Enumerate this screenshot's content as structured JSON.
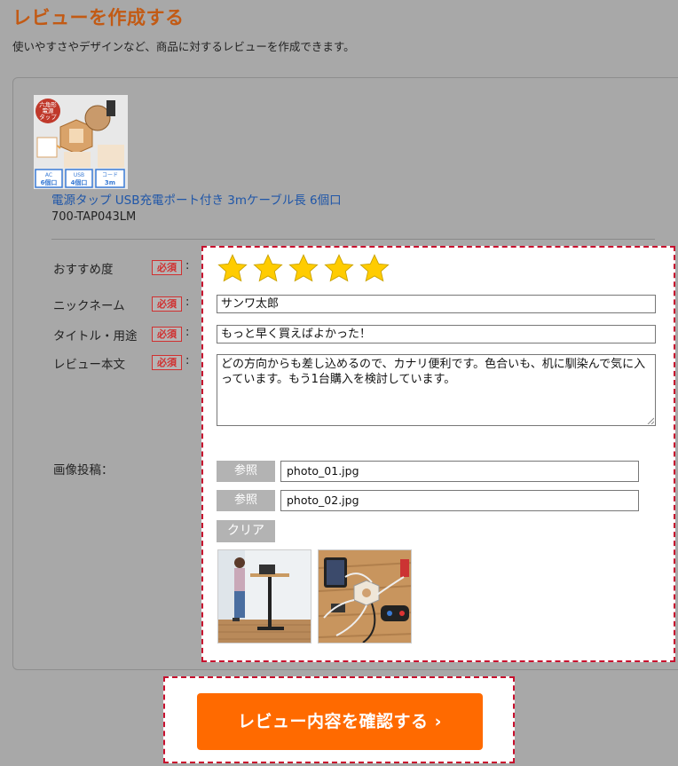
{
  "page": {
    "title": "レビューを作成する",
    "subtitle": "使いやすさやデザインなど、商品に対するレビューを作成できます。"
  },
  "product": {
    "image_labels": [
      "六角形",
      "電源",
      "タップ",
      "AC",
      "6個口",
      "USB",
      "4個口",
      "コード",
      "3m"
    ],
    "name": "電源タップ USB充電ポート付き 3mケーブル長 6個口",
    "code": "700-TAP043LM"
  },
  "form": {
    "required_label": "必須",
    "colon": ":",
    "rating_label": "おすすめ度",
    "rating_value": 5,
    "rating_max": 5,
    "nickname_label": "ニックネーム",
    "nickname_value": "サンワ太郎",
    "title_label": "タイトル・用途",
    "title_value": "もっと早く買えばよかった！",
    "body_label": "レビュー本文",
    "body_value": "どの方向からも差し込めるので、カナリ便利です。色合いも、机に馴染んで気に入っています。もう1台購入を検討しています。",
    "image_label": "画像投稿：",
    "browse_label": "参照",
    "files": [
      "photo_01.jpg",
      "photo_02.jpg"
    ],
    "clear_label": "クリア"
  },
  "submit_label": "レビュー内容を確認する ›",
  "colors": {
    "accent": "#ff6a00",
    "title": "#c25a14",
    "link": "#1f56a8",
    "required": "#d03030",
    "highlight_border": "#c8102e",
    "star": "#ffcc00"
  }
}
